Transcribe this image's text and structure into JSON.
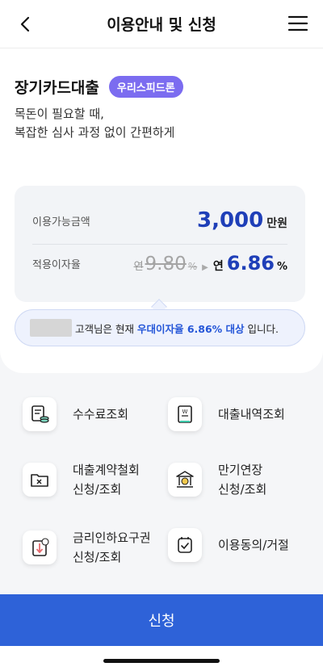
{
  "header": {
    "title": "이용안내 및 신청",
    "back_icon": "chevron-left-icon",
    "menu_icon": "hamburger-menu-icon"
  },
  "product": {
    "name": "장기카드대출",
    "badge": "우리스피드론",
    "desc_line1": "목돈이 필요할 때,",
    "desc_line2": "복잡한 심사 과정 없이 간편하게"
  },
  "limit": {
    "label": "이용가능금액",
    "amount": "3,000",
    "unit": "만원"
  },
  "rate": {
    "label": "적용이자율",
    "old_prefix": "연",
    "old_value": "9.80",
    "old_unit": "%",
    "new_prefix": "연",
    "new_value": "6.86",
    "new_unit": "%"
  },
  "notice": {
    "text_before": "고객님은 현재",
    "highlight": "우대이자율 6.86% 대상",
    "text_after": "입니다."
  },
  "menu": {
    "fee_inquiry": "수수료조회",
    "loan_history": "대출내역조회",
    "contract_withdrawal_l1": "대출계약철회",
    "contract_withdrawal_l2": "신청/조회",
    "maturity_extension_l1": "만기연장",
    "maturity_extension_l2": "신청/조회",
    "rate_cut_l1": "금리인하요구권",
    "rate_cut_l2": "신청/조회",
    "consent": "이용동의/거절"
  },
  "apply_label": "신청",
  "colors": {
    "accent": "#2e62d8",
    "badge": "#7b6cf0",
    "amount": "#1f3fb8",
    "highlight": "#2456d8"
  }
}
